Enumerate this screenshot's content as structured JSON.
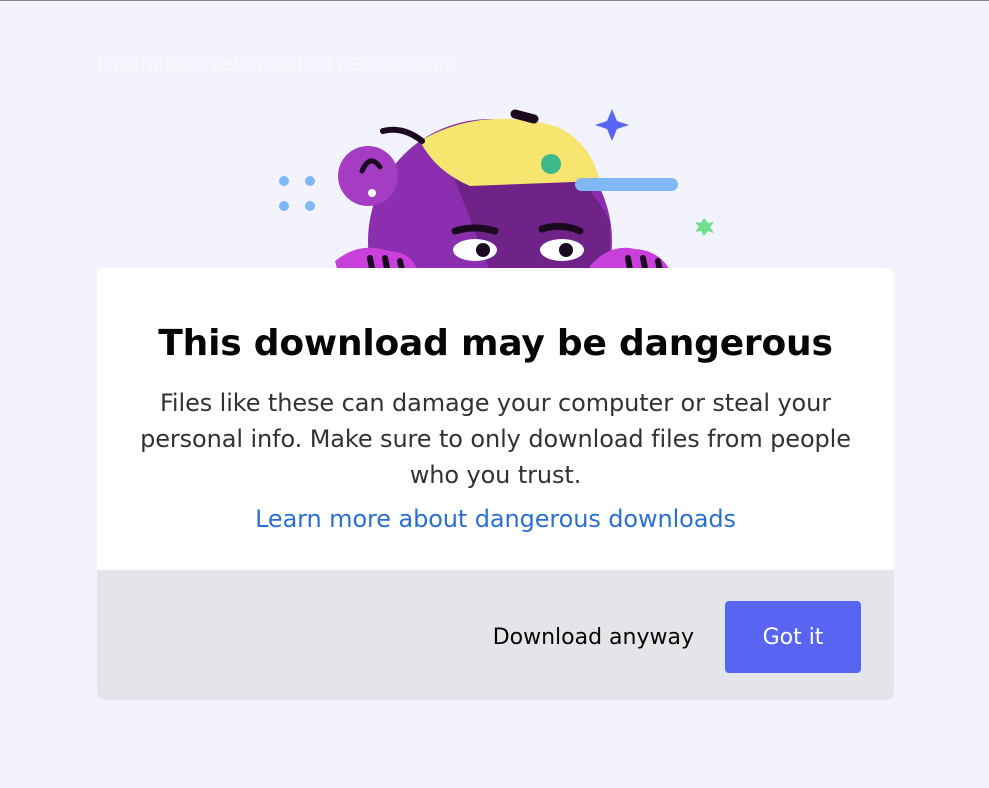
{
  "frame": {
    "label": "Illustration Peek Standard / Base / Dark"
  },
  "illustration": {
    "name": "peeking-character",
    "colors": {
      "head": "#8b2fb0",
      "hands": "#c83fdc",
      "cap": "#f6e56f",
      "brim": "#7fb8f5",
      "sparkle_blue": "#5865f2",
      "sparkle_green": "#6fe08a",
      "dots": "#7fb8f5"
    }
  },
  "modal": {
    "title": "This download may be dangerous",
    "description": "Files like these can damage your computer or steal your personal info. Make sure to only download files from people who you trust.",
    "learn_more_link": "Learn more about dangerous downloads",
    "secondary_button": "Download anyway",
    "primary_button": "Got it"
  },
  "colors": {
    "background": "#f3f3fd",
    "modal_bg": "#ffffff",
    "footer_bg": "#e3e5e8",
    "link": "#2b6fd1",
    "primary_button": "#5865f2"
  }
}
